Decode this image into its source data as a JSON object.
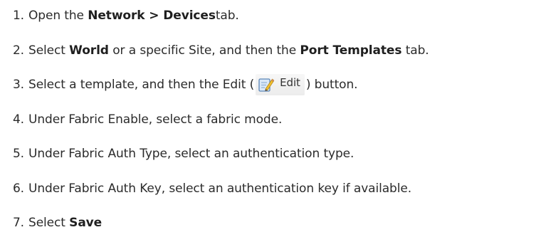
{
  "steps": [
    {
      "number": "1.",
      "t1": "Open the ",
      "b1": "Network > Devices",
      "t2": " tab."
    },
    {
      "number": "2.",
      "t1": "Select ",
      "b1": "World",
      "t2": " or a specific Site, and then the ",
      "b2": "Port Templates",
      "t3": " tab."
    },
    {
      "number": "3.",
      "t1": "Select a template, and then the Edit (",
      "button_label": "Edit",
      "t2": ") button."
    },
    {
      "number": "4.",
      "t1": "Under Fabric Enable, select a fabric mode."
    },
    {
      "number": "5.",
      "t1": "Under Fabric Auth Type, select an authentication type."
    },
    {
      "number": "6.",
      "t1": "Under Fabric Auth Key, select an authentication key if available."
    },
    {
      "number": "7.",
      "t1": "Select ",
      "b1": "Save"
    }
  ],
  "icons": {
    "edit": "edit-pencil-icon"
  }
}
